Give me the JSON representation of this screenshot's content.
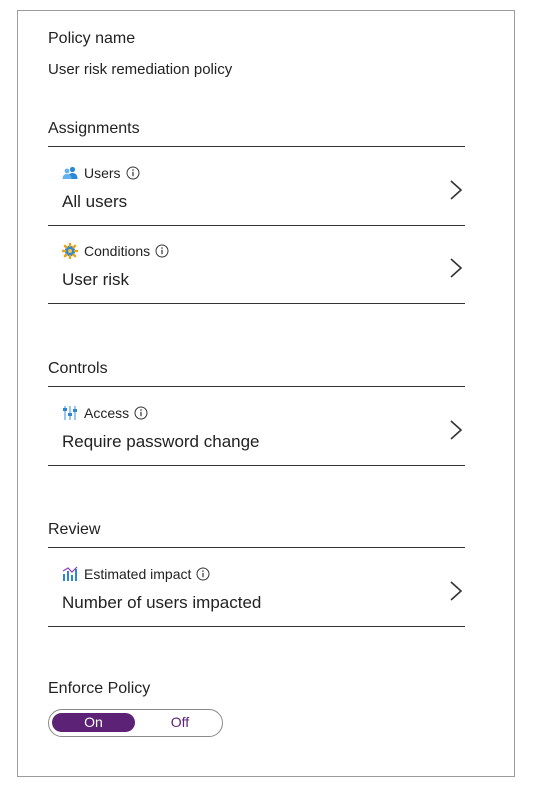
{
  "policy": {
    "name_label": "Policy name",
    "name_value": "User risk remediation policy"
  },
  "assignments": {
    "title": "Assignments",
    "items": [
      {
        "label": "Users",
        "value": "All users",
        "icon": "users-icon"
      },
      {
        "label": "Conditions",
        "value": "User risk",
        "icon": "conditions-icon"
      }
    ]
  },
  "controls": {
    "title": "Controls",
    "items": [
      {
        "label": "Access",
        "value": "Require password change",
        "icon": "access-controls-icon"
      }
    ]
  },
  "review": {
    "title": "Review",
    "items": [
      {
        "label": "Estimated impact",
        "value": "Number of users impacted",
        "icon": "chart-icon"
      }
    ]
  },
  "enforce": {
    "label": "Enforce Policy",
    "on_label": "On",
    "off_label": "Off",
    "selected": "On"
  },
  "colors": {
    "toggle_accent": "#5c2276",
    "icon_blue": "#2b88d8",
    "divider": "#333333"
  }
}
